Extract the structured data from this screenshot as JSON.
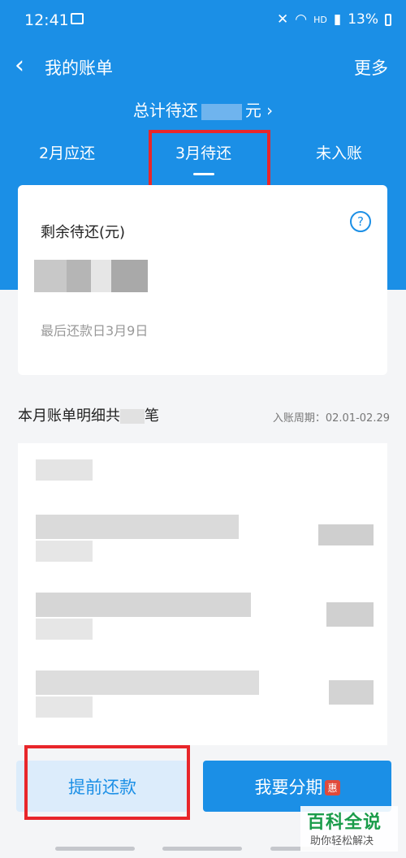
{
  "status": {
    "time": "12:41",
    "battery": "13%",
    "network": "HD"
  },
  "nav": {
    "back": "‹",
    "title": "我的账单",
    "more": "更多"
  },
  "total": {
    "prefix": "总计待还",
    "suffix": "元 ›"
  },
  "tabs": [
    {
      "label": "2月应还"
    },
    {
      "label": "3月待还",
      "active": true
    },
    {
      "label": "未入账"
    }
  ],
  "card": {
    "label": "剩余待还(元)",
    "help": "?",
    "due_date": "最后还款日3月9日"
  },
  "detail": {
    "title_prefix": "本月账单明细共",
    "title_suffix": "笔",
    "period": "入账周期：02.01-02.29"
  },
  "buttons": {
    "prepay": "提前还款",
    "installment": "我要分期",
    "badge": "惠"
  },
  "watermark": {
    "main": "百科全说",
    "sub": "助你轻松解决"
  },
  "colors": {
    "primary": "#1b8fe6",
    "highlight": "#e8262a"
  }
}
